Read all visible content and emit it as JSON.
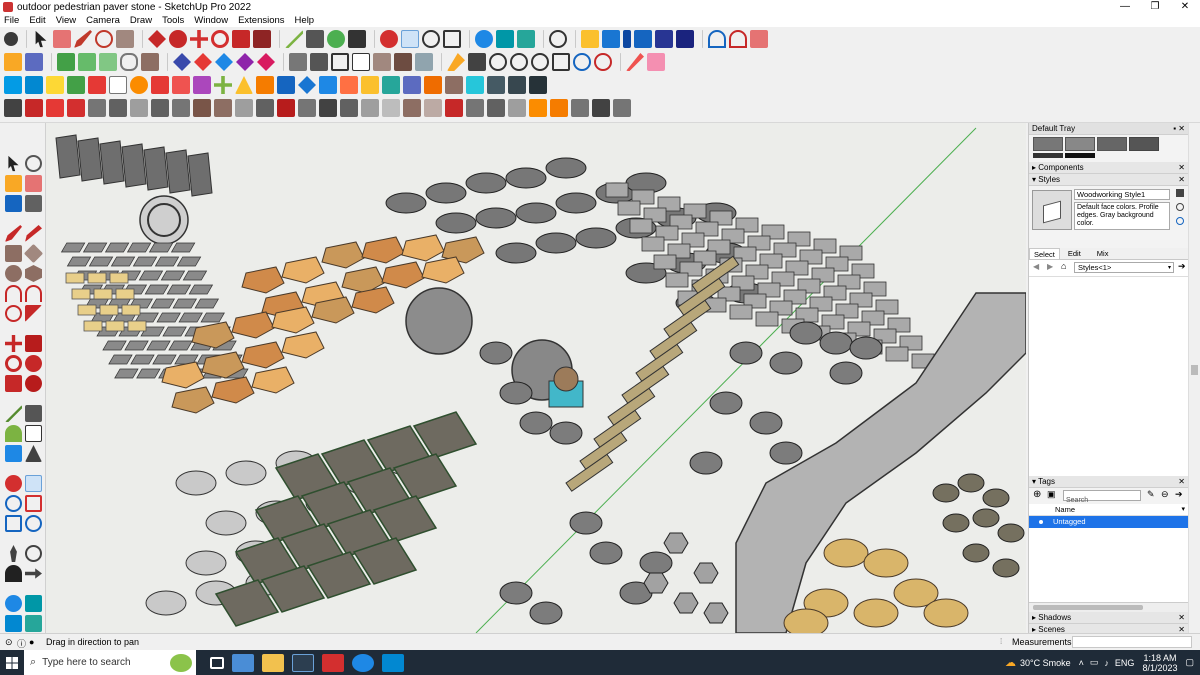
{
  "window": {
    "title": "outdoor pedestrian paver stone - SketchUp Pro 2022",
    "controls": [
      "—",
      "❐",
      "✕"
    ]
  },
  "menu": [
    "File",
    "Edit",
    "View",
    "Camera",
    "Draw",
    "Tools",
    "Window",
    "Extensions",
    "Help"
  ],
  "tray": {
    "title": "Default Tray",
    "components_label": "Components",
    "styles_label": "Styles",
    "style_name": "Woodworking Style1",
    "style_desc": "Default face colors. Profile edges. Gray background color.",
    "tabs": [
      "Select",
      "Edit",
      "Mix"
    ],
    "styles_select": "Styles<1>",
    "tags_label": "Tags",
    "tags_search_placeholder": "Search",
    "tags_col": "Name",
    "tags_item": "Untagged",
    "shadows_label": "Shadows",
    "scenes_label": "Scenes"
  },
  "status": {
    "hint": "Drag in direction to pan",
    "measurements_label": "Measurements"
  },
  "taskbar": {
    "search_placeholder": "Type here to search",
    "weather": "30°C  Smoke",
    "lang": "ENG",
    "time": "1:18 AM",
    "date": "8/1/2023"
  },
  "scene_text": [
    "",
    "",
    "",
    "",
    "",
    ""
  ],
  "colors": {
    "accent_selected": "#1e73e8",
    "taskbar": "#1f2b38",
    "viewport_bg": "#ecedea",
    "axis_green": "#4caf50"
  }
}
